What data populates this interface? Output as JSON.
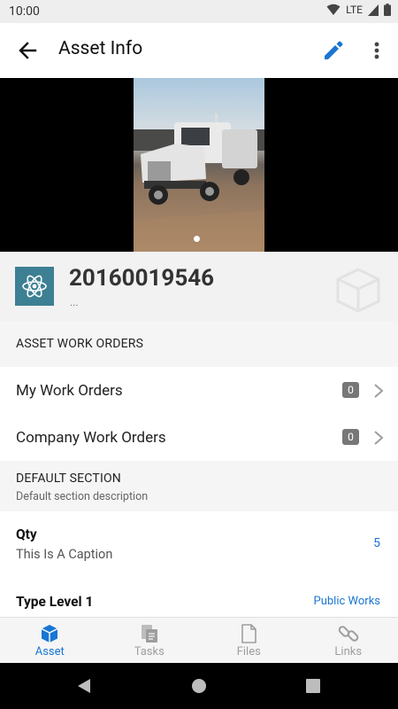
{
  "status": {
    "time": "10:00",
    "network": "LTE"
  },
  "app_bar": {
    "title": "Asset Info",
    "back_icon": "arrow-left-icon",
    "edit_icon": "pencil-icon",
    "more_icon": "more-vert-icon",
    "accent": "#1976d2"
  },
  "asset": {
    "id": "20160019546",
    "subtitle": "...",
    "icon": "atom-icon",
    "icon_bg": "#3d7f93"
  },
  "work_orders": {
    "section_title": "ASSET WORK ORDERS",
    "items": [
      {
        "label": "My Work Orders",
        "count": "0"
      },
      {
        "label": "Company Work Orders",
        "count": "0"
      }
    ]
  },
  "default_section": {
    "title": "DEFAULT SECTION",
    "description": "Default section description",
    "fields": [
      {
        "label": "Qty",
        "caption": "This Is A Caption",
        "value": "5"
      },
      {
        "label": "Type Level 1",
        "value": "Public Works"
      }
    ]
  },
  "bottom_nav": {
    "tabs": [
      {
        "label": "Asset",
        "icon": "cube-icon",
        "active": true
      },
      {
        "label": "Tasks",
        "icon": "tasks-icon",
        "active": false
      },
      {
        "label": "Files",
        "icon": "file-icon",
        "active": false
      },
      {
        "label": "Links",
        "icon": "link-icon",
        "active": false
      }
    ]
  }
}
